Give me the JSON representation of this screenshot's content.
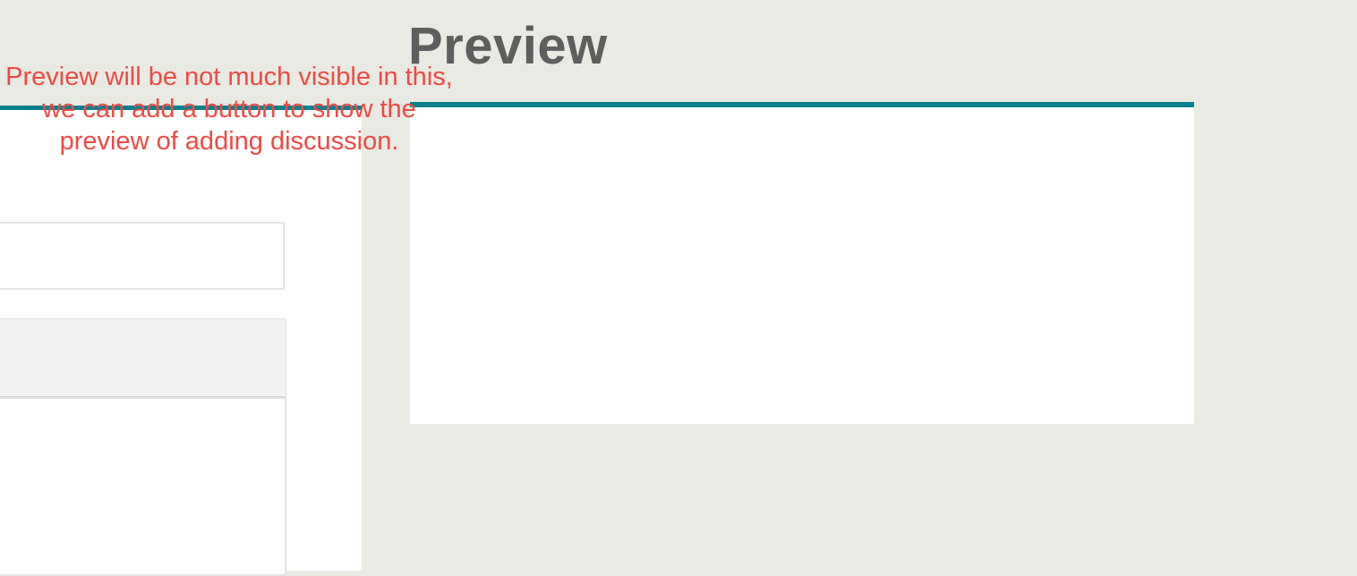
{
  "preview": {
    "title": "Preview"
  },
  "annotation": {
    "text": "Preview will be not much visible in this, we can add a button  to show the preview of adding discussion."
  },
  "colors": {
    "background": "#e9eae4",
    "accent": "#0a7f8f",
    "annotation": "#ef4a43",
    "title": "#5e5e5e"
  }
}
